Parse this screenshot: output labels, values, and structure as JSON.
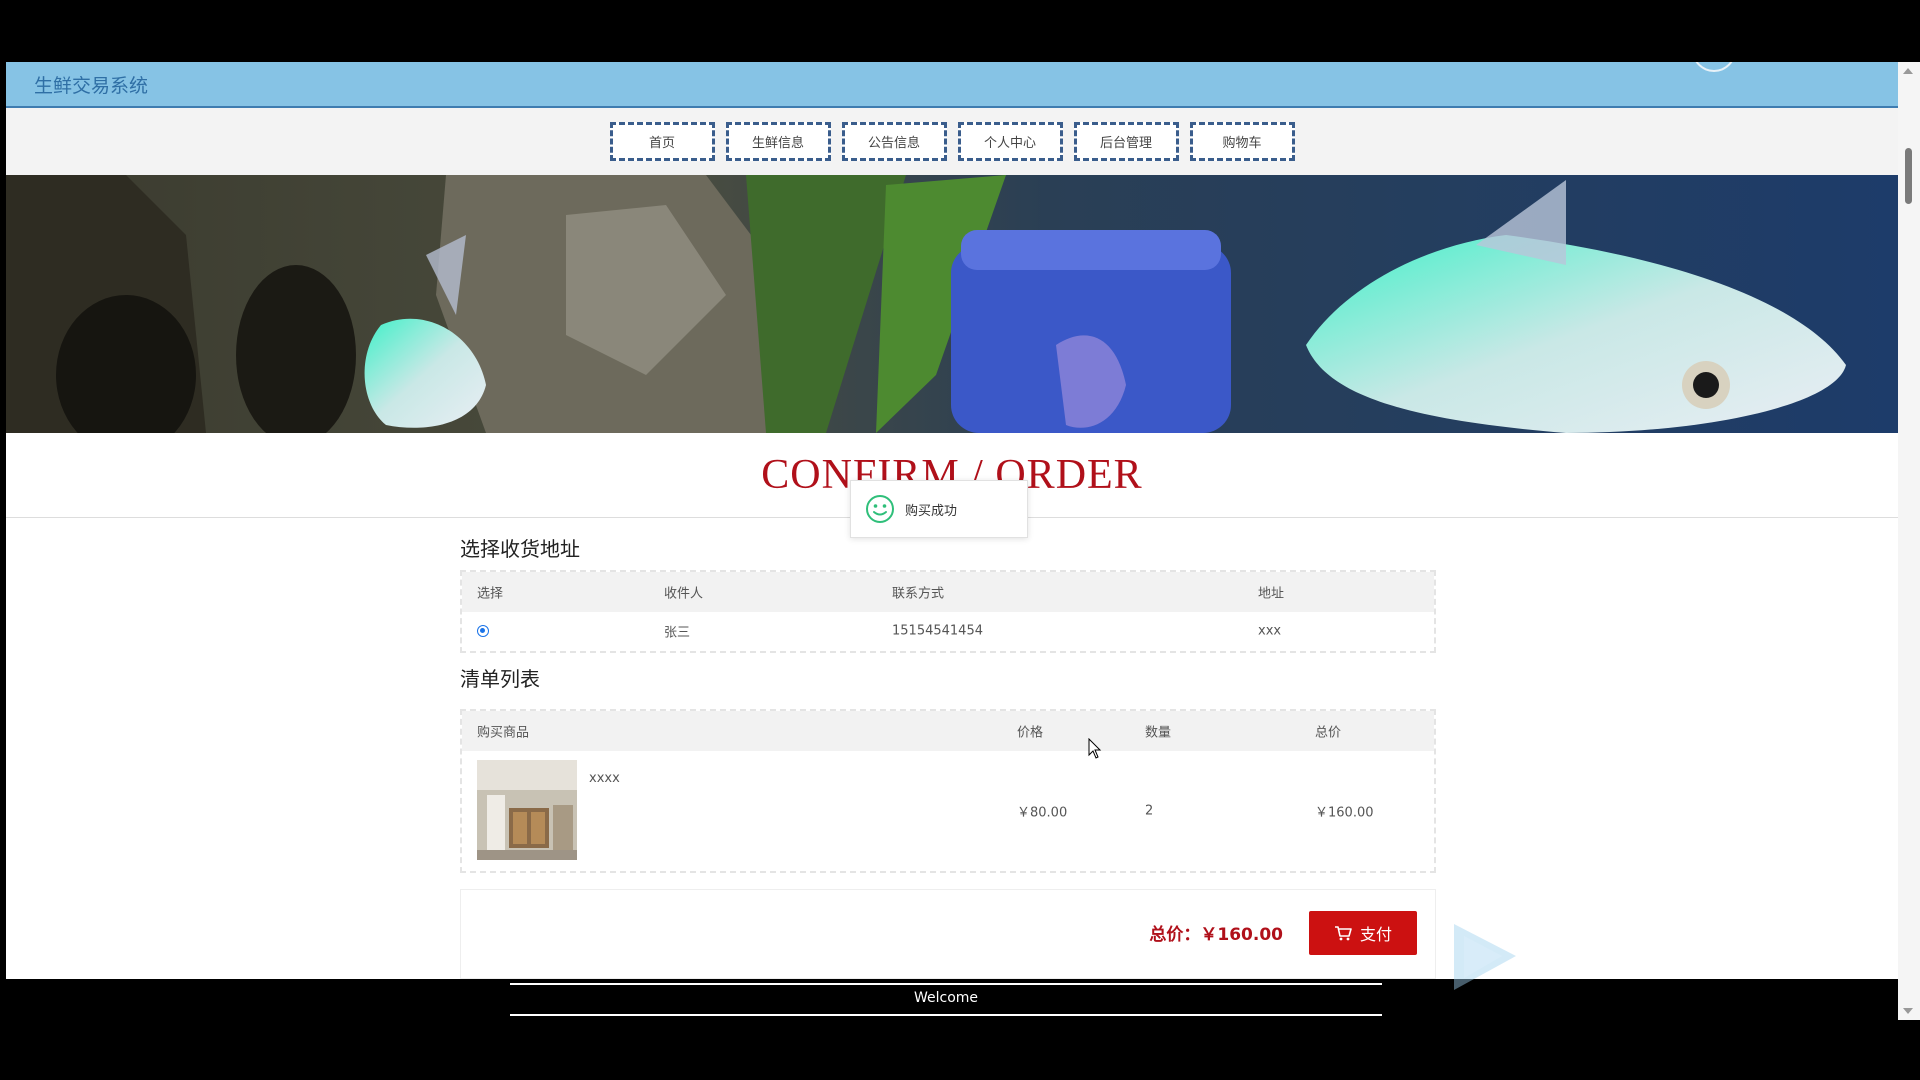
{
  "site": {
    "title": "生鲜交易系统"
  },
  "nav": {
    "items": [
      {
        "label": "首页"
      },
      {
        "label": "生鲜信息"
      },
      {
        "label": "公告信息"
      },
      {
        "label": "个人中心"
      },
      {
        "label": "后台管理"
      },
      {
        "label": "购物车"
      }
    ]
  },
  "page": {
    "heading": "CONFIRM / ORDER"
  },
  "toast": {
    "message": "购买成功"
  },
  "address": {
    "section_title": "选择收货地址",
    "headers": {
      "select": "选择",
      "receiver": "收件人",
      "contact": "联系方式",
      "address": "地址"
    },
    "rows": [
      {
        "selected": true,
        "receiver": "张三",
        "contact": "15154541454",
        "address": "xxx"
      }
    ]
  },
  "items": {
    "section_title": "清单列表",
    "headers": {
      "product": "购买商品",
      "price": "价格",
      "quantity": "数量",
      "subtotal": "总价"
    },
    "rows": [
      {
        "name": "xxxx",
        "price": "￥80.00",
        "quantity": "2",
        "subtotal": "￥160.00"
      }
    ]
  },
  "summary": {
    "total_label": "总价：￥160.00",
    "pay_label": "支付"
  },
  "footer": {
    "welcome": "Welcome"
  },
  "colors": {
    "accent_red": "#cc1111",
    "header_blue": "#86c3e5",
    "nav_border": "#3a5d8c"
  }
}
